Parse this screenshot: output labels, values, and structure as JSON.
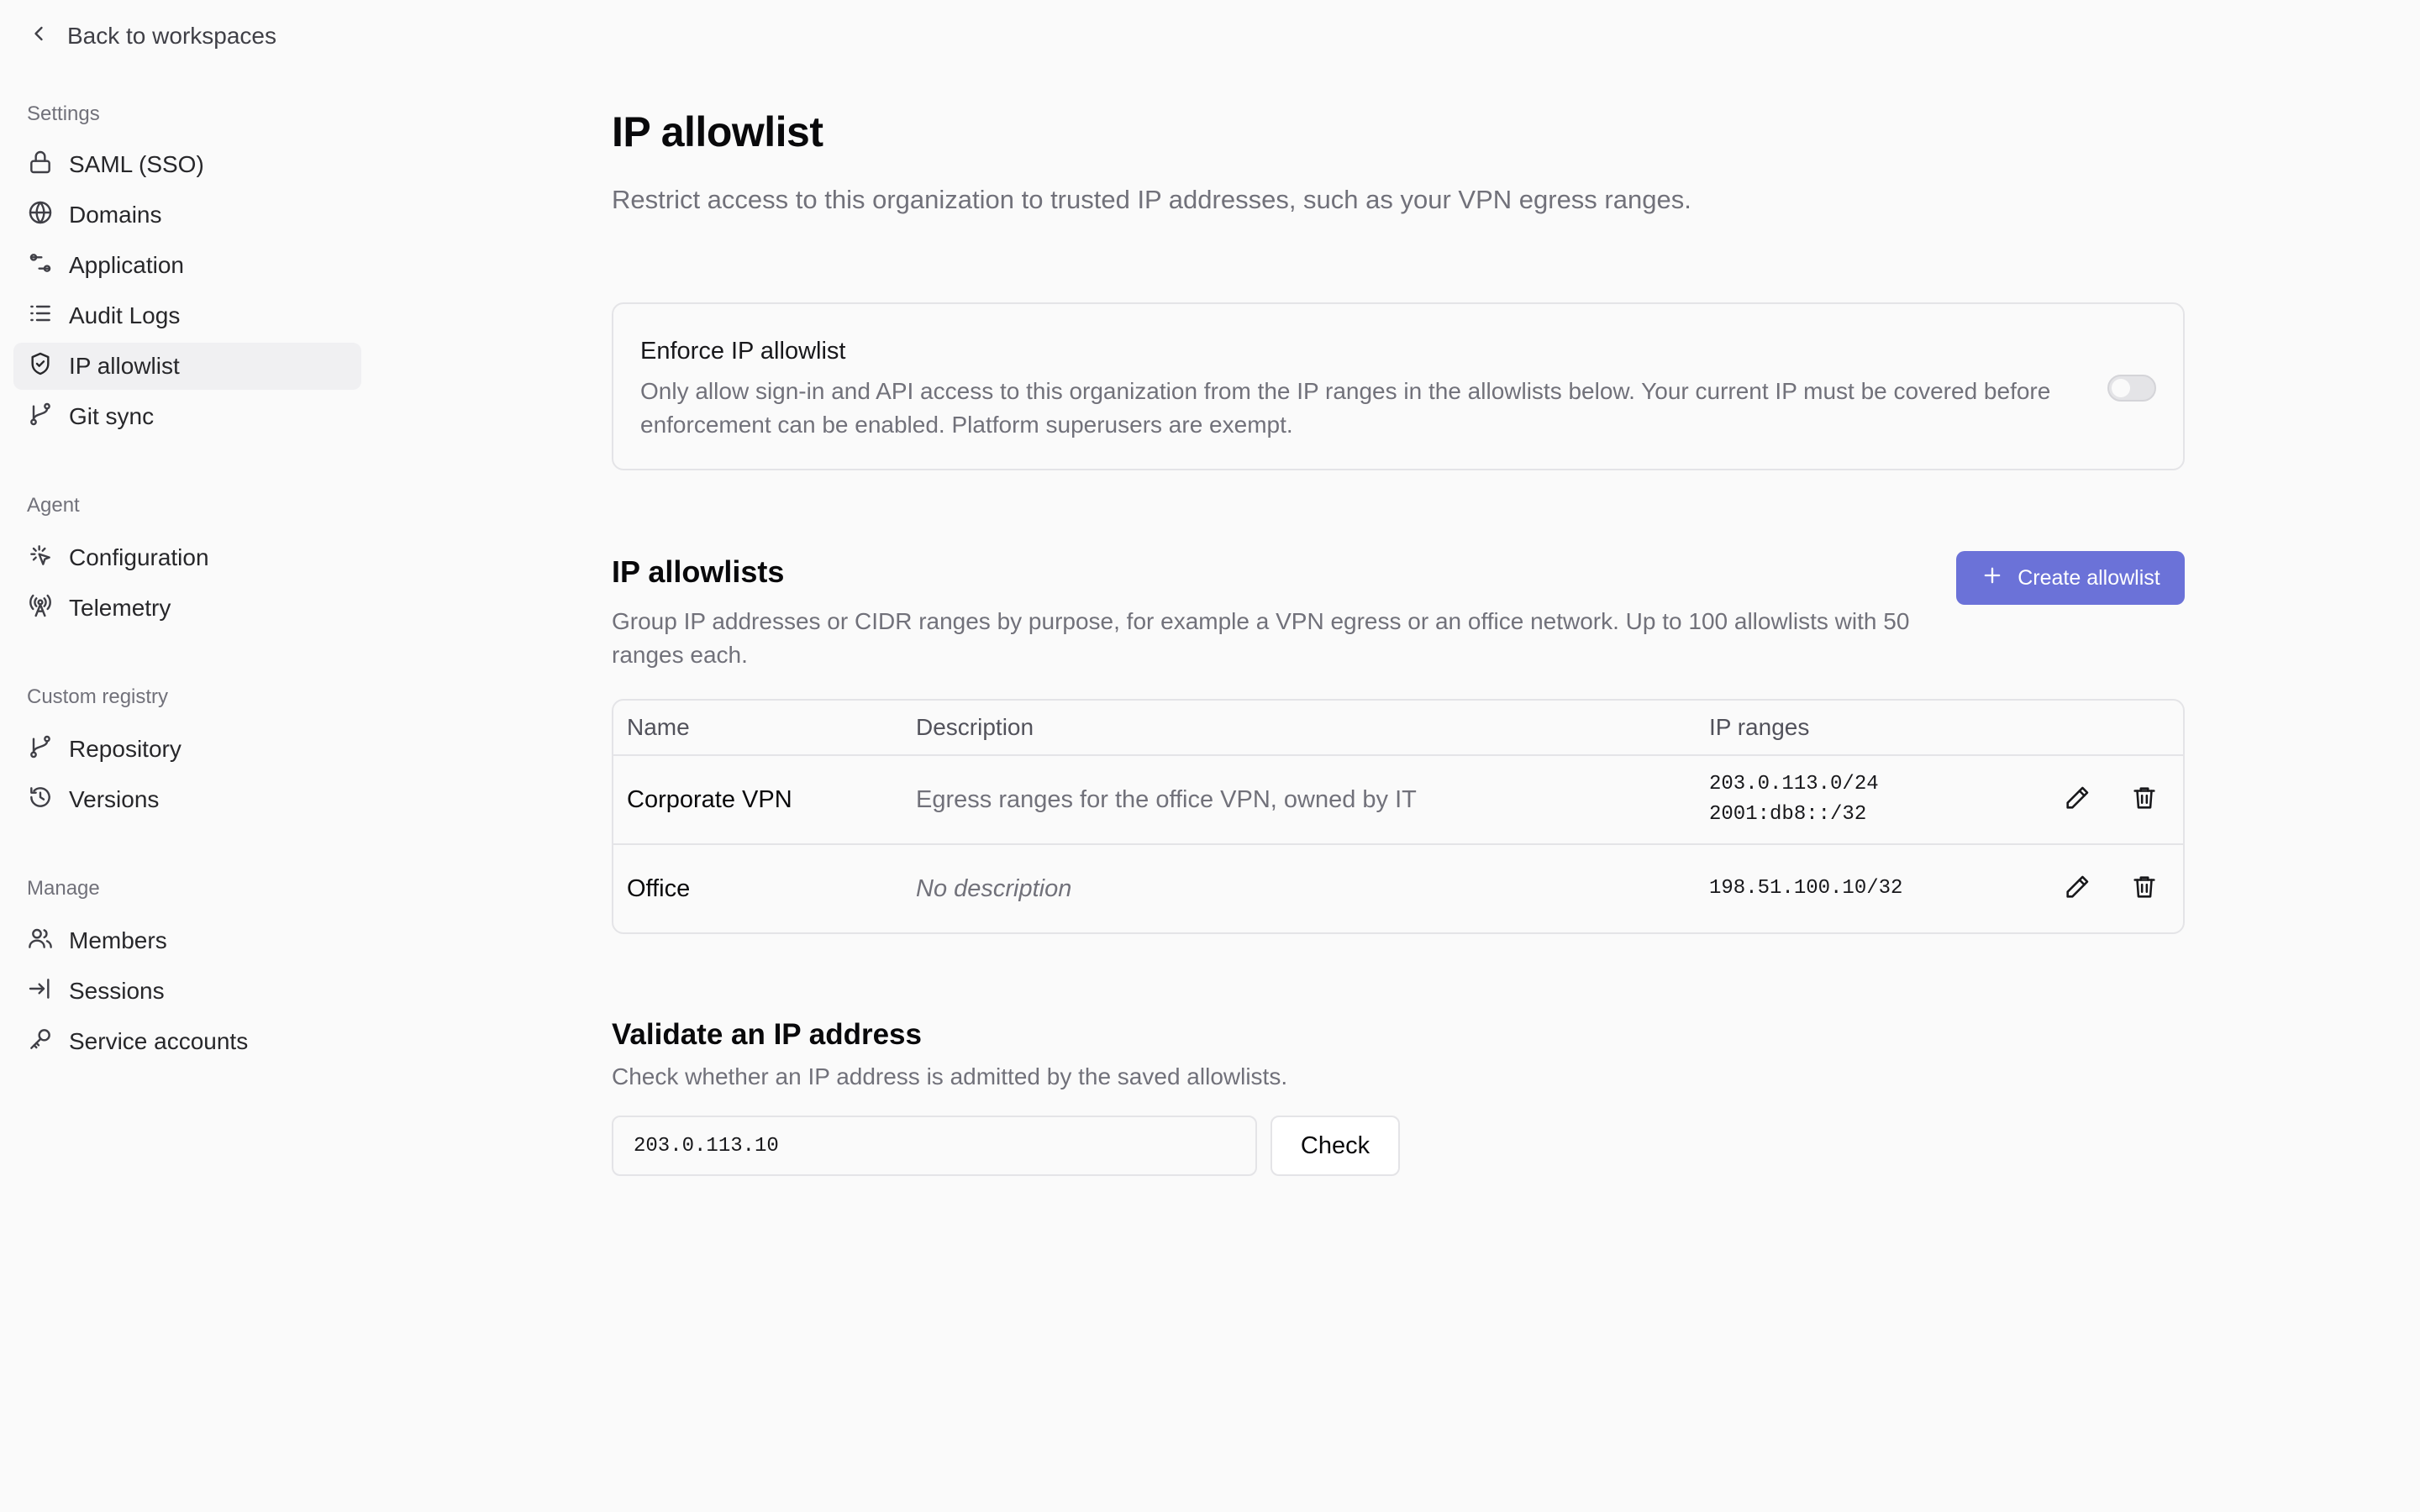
{
  "sidebar": {
    "back_label": "Back to workspaces",
    "sections": [
      {
        "label": "Settings",
        "items": [
          {
            "label": "SAML (SSO)",
            "icon": "lock-icon"
          },
          {
            "label": "Domains",
            "icon": "globe-icon"
          },
          {
            "label": "Application",
            "icon": "sliders-icon"
          },
          {
            "label": "Audit Logs",
            "icon": "list-icon"
          },
          {
            "label": "IP allowlist",
            "icon": "shield-check-icon",
            "active": true
          },
          {
            "label": "Git sync",
            "icon": "git-branch-icon"
          }
        ]
      },
      {
        "label": "Agent",
        "items": [
          {
            "label": "Configuration",
            "icon": "sparkle-cursor-icon"
          },
          {
            "label": "Telemetry",
            "icon": "antenna-icon"
          }
        ]
      },
      {
        "label": "Custom registry",
        "items": [
          {
            "label": "Repository",
            "icon": "git-branch-icon"
          },
          {
            "label": "Versions",
            "icon": "history-icon"
          }
        ]
      },
      {
        "label": "Manage",
        "items": [
          {
            "label": "Members",
            "icon": "users-icon"
          },
          {
            "label": "Sessions",
            "icon": "sign-in-icon"
          },
          {
            "label": "Service accounts",
            "icon": "key-icon"
          }
        ]
      }
    ]
  },
  "main": {
    "title": "IP allowlist",
    "subtitle": "Restrict access to this organization to trusted IP addresses, such as your VPN egress ranges.",
    "enforce": {
      "title": "Enforce IP allowlist",
      "description": "Only allow sign-in and API access to this organization from the IP ranges in the allowlists below. Your current IP must be covered before enforcement can be enabled. Platform superusers are exempt.",
      "enabled": false
    },
    "allowlists": {
      "title": "IP allowlists",
      "description": "Group IP addresses or CIDR ranges by purpose, for example a VPN egress or an office network. Up to 100 allowlists with 50 ranges each.",
      "create_label": "Create allowlist",
      "columns": {
        "name": "Name",
        "description": "Description",
        "ranges": "IP ranges"
      },
      "rows": [
        {
          "name": "Corporate VPN",
          "description": "Egress ranges for the office VPN, owned by IT",
          "ranges": [
            "203.0.113.0/24",
            "2001:db8::/32"
          ]
        },
        {
          "name": "Office",
          "description": "No description",
          "ranges": [
            "198.51.100.10/32"
          ]
        }
      ]
    },
    "validate": {
      "title": "Validate an IP address",
      "description": "Check whether an IP address is admitted by the saved allowlists.",
      "input_value": "203.0.113.10",
      "check_label": "Check"
    }
  },
  "colors": {
    "background": "#fafafa",
    "accent": "#6b72d8",
    "muted_text": "#71717a",
    "border": "#e4e4e7",
    "active_nav": "#f0f0f2"
  }
}
